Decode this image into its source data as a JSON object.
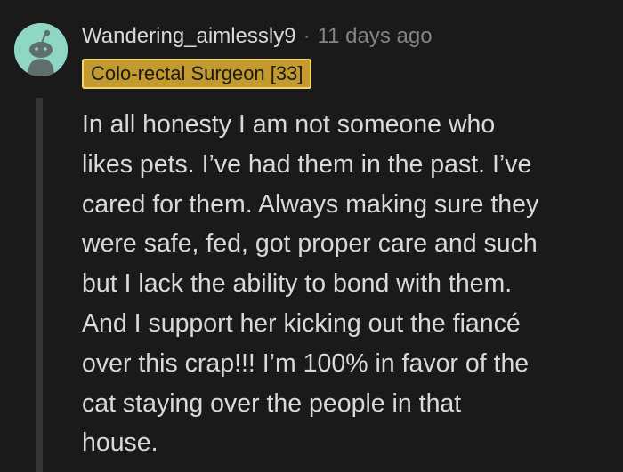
{
  "comment": {
    "avatar_icon": "reddit-snoo-avatar-icon",
    "username": "Wandering_aimlessly9",
    "separator": "·",
    "timestamp": "11 days ago",
    "flair": "Colo-rectal Surgeon [33]",
    "body_lines": [
      "In all honesty I am not someone who",
      "likes pets. I’ve had them in the past. I’ve",
      "cared for them. Always making sure they",
      "were safe, fed, got proper care and such",
      "but I lack the ability to bond with them.",
      "And I support her kicking out the fiancé",
      "over this crap!!! I’m 100% in favor of the",
      "cat staying over the people in that",
      "house."
    ]
  },
  "colors": {
    "background": "#1a1a1b",
    "text": "#d7dadc",
    "meta": "#818384",
    "thread_line": "#343536",
    "avatar_bg": "#8fd7c4",
    "flair_bg": "#c39a2d"
  }
}
